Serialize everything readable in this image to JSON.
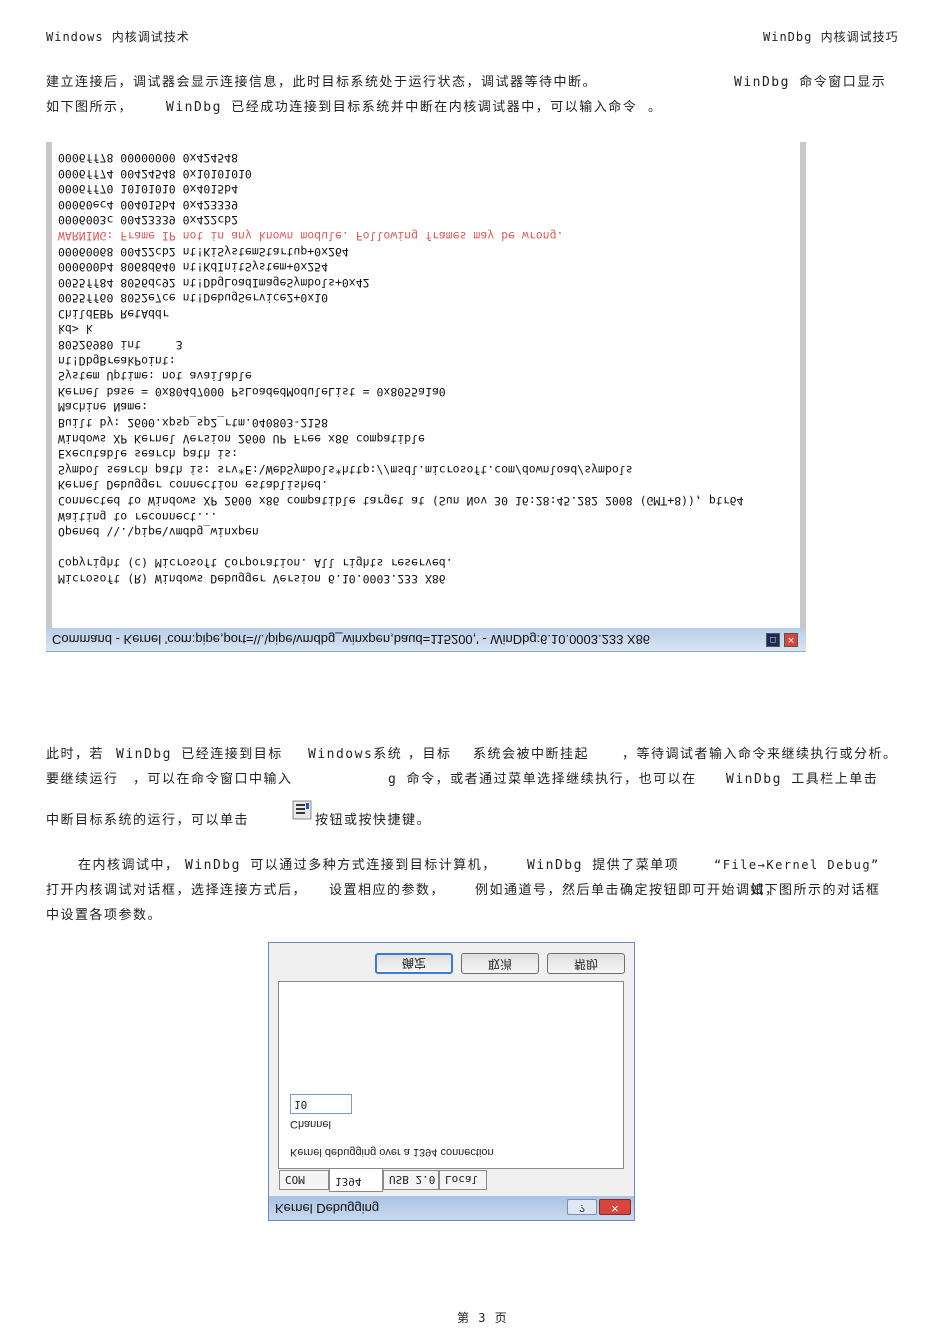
{
  "header": {
    "left": "Windows 内核调试技术",
    "right": "WinDbg 内核调试技巧"
  },
  "paragraphs": {
    "p1_line1": "建立连接后，调试器会显示连接信息，此时目标系统处于运行状态，调试器等待中断。",
    "p1_line1_tail": "WinDbg 命令窗口显示",
    "p1_line2a": "如下图所示，",
    "p1_line2b": "WinDbg 已经成功连接到目标系统并中断在内核调试器中，可以输入命令",
    "p1_line2c": "。",
    "p2_line1a": "此时，若",
    "p2_line1b": "WinDbg 已经连接到目标",
    "p2_line1c": "Windows系统",
    "p2_line1d": "，目标",
    "p2_line1e": "系统会被中断挂起",
    "p2_line1f": "，等待调试者输入命令来继续执行或分析。",
    "p2_line2a": "要继续运行",
    "p2_line2b": "，可以在命令窗口中输入",
    "p2_line2c": "g 命令，或者通过菜单选择继续执行，也可以在",
    "p2_line2d": "WinDbg 工具栏上单击",
    "p2_line3a": "中断目标系统的运行，可以单击",
    "p2_line3b": "按钮或按快捷键。",
    "p3_line1a": "在内核调试中，",
    "p3_line1b": "WinDbg 可以通过多种方式连接到目标计算机，",
    "p3_line1c": "WinDbg 提供了菜单项",
    "p3_line1d": "“File→Kernel Debug”",
    "p3_line2a": "打开内核调试对话框，选择连接方式后，",
    "p3_line2b": "设置相应的参数，",
    "p3_line2c": "例如通道号，然后单击确定按钮即可开始调试，",
    "p3_line2d": "如下图所示的对话框",
    "p3_line3": "中设置各项参数。"
  },
  "windbg_screenshot": {
    "title": "Command - Kernel 'com:pipe,port=\\\\.\\pipe\\vmdbg_winxpen,baud=115200,' - WinDbg:6.10.0003.233 X86",
    "lines": [
      "Microsoft (R) Windows Debugger Version 6.10.0003.233 X86",
      "Copyright (c) Microsoft Corporation. All rights reserved.",
      "",
      "Opened \\\\.\\pipe\\vmdbg_winxpen",
      "Waiting to reconnect...",
      "Connected to Windows XP 2600 x86 compatible target at (Sun Nov 30 16:28:45.282 2008 (GMT+8)), ptr64",
      "Kernel Debugger connection established.",
      "Symbol search path is: srv*E:\\WebSymbols*http://msdl.microsoft.com/download/symbols",
      "Executable search path is:",
      "Windows XP Kernel Version 2600 UP Free x86 compatible",
      "Built by: 2600.xpsp_sp2_rtm.040803-2158",
      "Machine Name:",
      "Kernel base = 0x804d7000 PsLoadedModuleList = 0x8055a1a0",
      "System Uptime: not available",
      "nt!DbgBreakPoint:",
      "80526980 int     3",
      "kd> k",
      "ChildEBP RetAddr",
      "0055ff60 8052e7ce nt!DebugService2+0x10",
      "0055ff84 8056dc92 nt!DbgLoadImageSymbols+0x42",
      "000600b4 8068d640 nt!KdInitSystem+0x254",
      "00060068 00422cb2 nt!KiSystemStartup+0x264",
      "WARNING: Frame IP not in any known module. Following frames may be wrong.",
      "0006003c 00423339 0x422cb2",
      "00060ec4 004015b4 0x423339",
      "0006ff70 10101010 0x4015b4",
      "0006ff74 00424548 0x10101010",
      "0006ff78 00000000 0x424548"
    ],
    "warning_line_index": 22
  },
  "kernel_dialog": {
    "title": "Kernel Debugging",
    "tabs": [
      "COM",
      "1394",
      "USB 2.0",
      "Local"
    ],
    "active_tab": "1394",
    "description": "Kernel debugging over a 1394 connection",
    "channel_label": "Channel",
    "channel_value": "10",
    "buttons": {
      "ok": "确定",
      "cancel": "取消",
      "help": "帮助"
    }
  },
  "footer": {
    "page": "第 3 页"
  },
  "colors": {
    "warning": "#e05a5a",
    "titlebar": "#c9d9ee",
    "close": "#d8453a"
  }
}
